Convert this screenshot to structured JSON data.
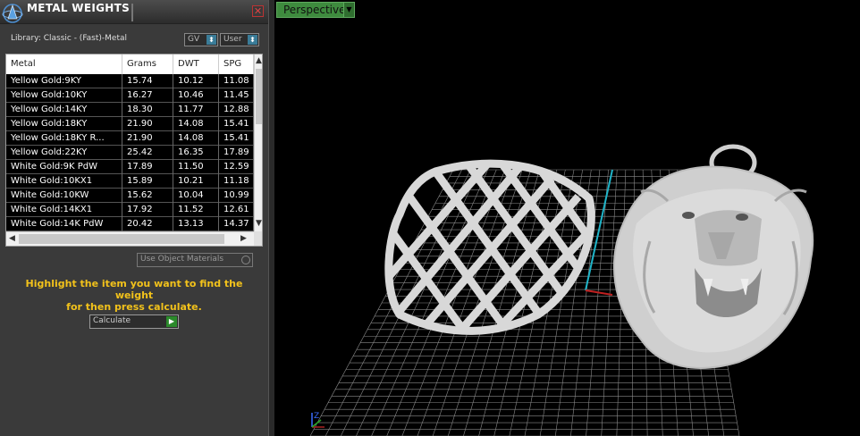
{
  "panel": {
    "title": "METAL WEIGHTS",
    "close_glyph": "✕",
    "library_label": "Library: Classic - (Fast)-Metal",
    "selects": [
      {
        "label": "GV",
        "arrow": "⬍"
      },
      {
        "label": "User",
        "arrow": "⬍"
      }
    ],
    "table": {
      "columns": [
        "Metal",
        "Grams",
        "DWT",
        "SPG"
      ],
      "rows": [
        [
          "Yellow Gold:9KY",
          "15.74",
          "10.12",
          "11.08"
        ],
        [
          "Yellow Gold:10KY",
          "16.27",
          "10.46",
          "11.45"
        ],
        [
          "Yellow Gold:14KY",
          "18.30",
          "11.77",
          "12.88"
        ],
        [
          "Yellow Gold:18KY",
          "21.90",
          "14.08",
          "15.41"
        ],
        [
          "Yellow Gold:18KY R...",
          "21.90",
          "14.08",
          "15.41"
        ],
        [
          "Yellow Gold:22KY",
          "25.42",
          "16.35",
          "17.89"
        ],
        [
          "White Gold:9K PdW",
          "17.89",
          "11.50",
          "12.59"
        ],
        [
          "White Gold:10KX1",
          "15.89",
          "10.21",
          "11.18"
        ],
        [
          "White Gold:10KW",
          "15.62",
          "10.04",
          "10.99"
        ],
        [
          "White Gold:14KX1",
          "17.92",
          "11.52",
          "12.61"
        ],
        [
          "White Gold:14K PdW",
          "20.42",
          "13.13",
          "14.37"
        ]
      ]
    },
    "use_object_materials": "Use Object Materials",
    "hint_line1": "Highlight the item you want to find the weight",
    "hint_line2": "for then press calculate.",
    "calculate_label": "Calculate",
    "calculate_icon": "▶"
  },
  "viewport": {
    "view_label": "Perspective",
    "dropdown_glyph": "▼",
    "axis_label": "Z"
  },
  "colors": {
    "accent_green": "#3e8b3e",
    "hint_yellow": "#f2c21b",
    "grid": "#8a8a8a",
    "model": "#d8d8d8"
  }
}
